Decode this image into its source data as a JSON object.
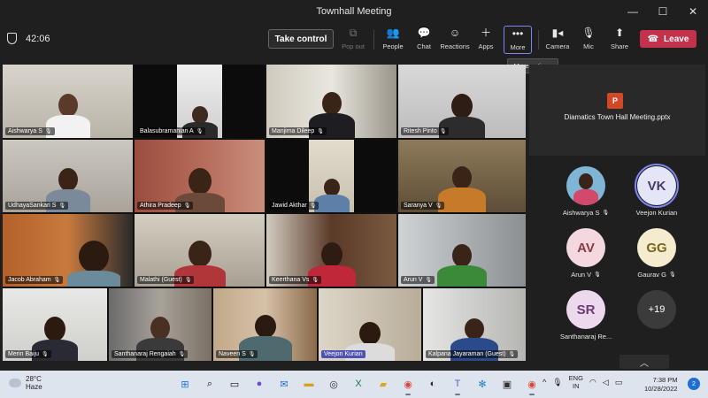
{
  "window": {
    "title": "Townhall Meeting",
    "minimize_icon": "minimize-icon",
    "maximize_icon": "maximize-icon",
    "close_icon": "close-icon"
  },
  "toolbar": {
    "timer": "42:06",
    "take_control": "Take control",
    "buttons": [
      {
        "label": "Pop out",
        "icon": "pop-out-icon",
        "disabled": true
      },
      {
        "label": "People",
        "icon": "people-icon"
      },
      {
        "label": "Chat",
        "icon": "chat-icon"
      },
      {
        "label": "Reactions",
        "icon": "reactions-icon"
      },
      {
        "label": "Apps",
        "icon": "apps-icon"
      },
      {
        "label": "More",
        "icon": "more-icon",
        "active": true
      },
      {
        "label": "Camera",
        "icon": "camera-icon"
      },
      {
        "label": "Mic",
        "icon": "mic-off-icon"
      },
      {
        "label": "Share",
        "icon": "share-icon"
      }
    ],
    "leave": "Leave",
    "leave_color": "#c4314b"
  },
  "tooltip": "More actions",
  "grid": {
    "tiles": [
      {
        "name": "Aishwarya S"
      },
      {
        "name": "Balasubramanian A"
      },
      {
        "name": "Manjima Dileep"
      },
      {
        "name": "Ritesh Pinto"
      },
      {
        "name": "UdhayaSankari S"
      },
      {
        "name": "Athira Pradeep"
      },
      {
        "name": "Jawid Akthar"
      },
      {
        "name": "Saranya V"
      },
      {
        "name": "Jacob Abraham"
      },
      {
        "name": "Malathi (Guest)"
      },
      {
        "name": "Keerthana Vs"
      },
      {
        "name": "Arun V"
      },
      {
        "name": "Merin Baiju"
      },
      {
        "name": "Santhanaraj Rengaiah"
      },
      {
        "name": "Naveen S"
      },
      {
        "name": "Veejon Kurian"
      },
      {
        "name": "Kalpana Jayaraman (Guest)"
      }
    ]
  },
  "panel": {
    "shared_file": "Diamatics Town Hall Meeting.pptx",
    "participants": [
      {
        "name": "Aishwarya S",
        "initials": "",
        "color": "#7fb6d5"
      },
      {
        "name": "Veejon Kurian",
        "initials": "VK",
        "color": "#e4e6f7"
      },
      {
        "name": "Arun V",
        "initials": "AV",
        "color": "#f3d9de"
      },
      {
        "name": "Gaurav G",
        "initials": "GG",
        "color": "#f3eccd"
      },
      {
        "name": "Santhanaraj Re...",
        "initials": "SR",
        "color": "#ecd9ee"
      }
    ],
    "more_count": "+19"
  },
  "taskbar": {
    "weather_temp": "28°C",
    "weather_desc": "Haze",
    "lang_1": "ENG",
    "lang_2": "IN",
    "time": "7:38 PM",
    "date": "10/28/2022",
    "notifications": "2"
  }
}
